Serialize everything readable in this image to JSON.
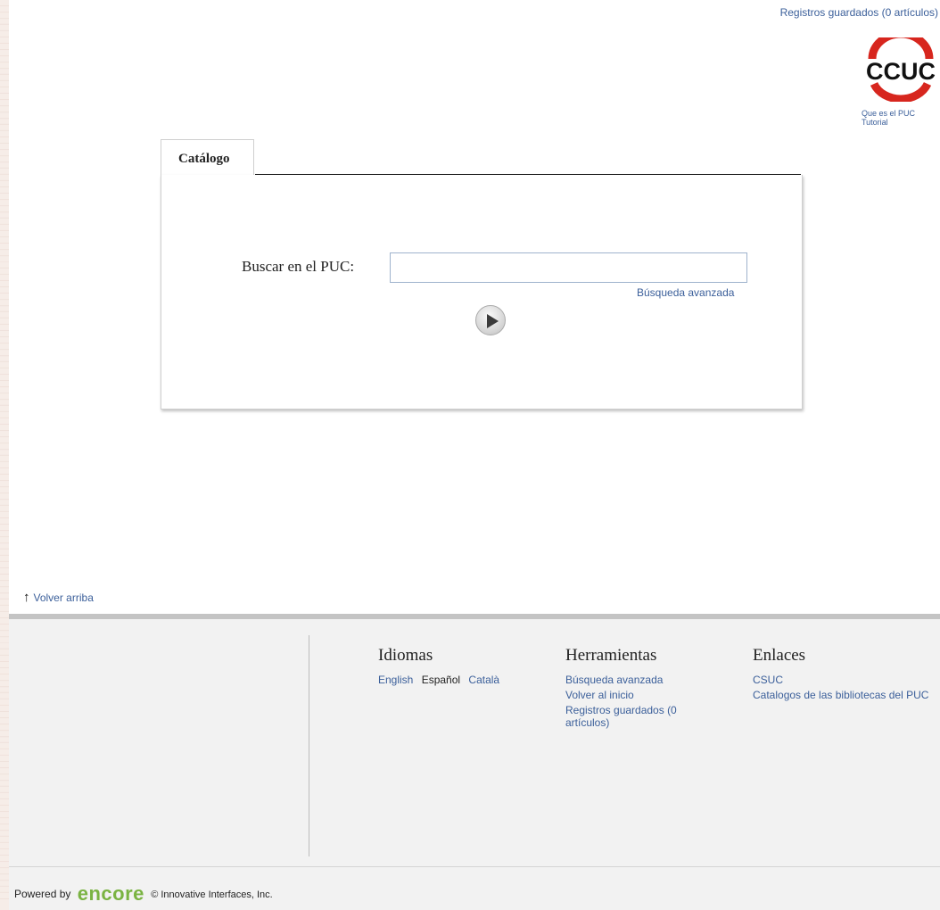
{
  "header": {
    "saved_records": "Registros guardados (0 artículos)",
    "logo_text": "CCUC",
    "logo_links": [
      "Que es el PUC",
      "Tutorial"
    ]
  },
  "search": {
    "tab_label": "Catálogo",
    "label": "Buscar en el PUC:",
    "input_value": "",
    "placeholder": "",
    "advanced_link": "Búsqueda avanzada",
    "go_icon": "play-icon"
  },
  "back_to_top": {
    "arrow": "↑",
    "label": "Volver arriba"
  },
  "footer": {
    "idiomas": {
      "title": "Idiomas",
      "langs": [
        "English",
        "Español",
        "Català"
      ]
    },
    "herramientas": {
      "title": "Herramientas",
      "links": [
        "Búsqueda avanzada",
        "Volver al inicio",
        "Registros guardados (0 artículos)"
      ]
    },
    "enlaces": {
      "title": "Enlaces",
      "links": [
        "CSUC",
        "Catalogos de las bibliotecas del PUC"
      ]
    },
    "powered_by": "Powered by",
    "brand": "encore",
    "copyright": "© Innovative Interfaces, Inc."
  },
  "colors": {
    "link": "#3b5f9a",
    "logo_red": "#d7261e",
    "brand_green": "#7ab342"
  }
}
